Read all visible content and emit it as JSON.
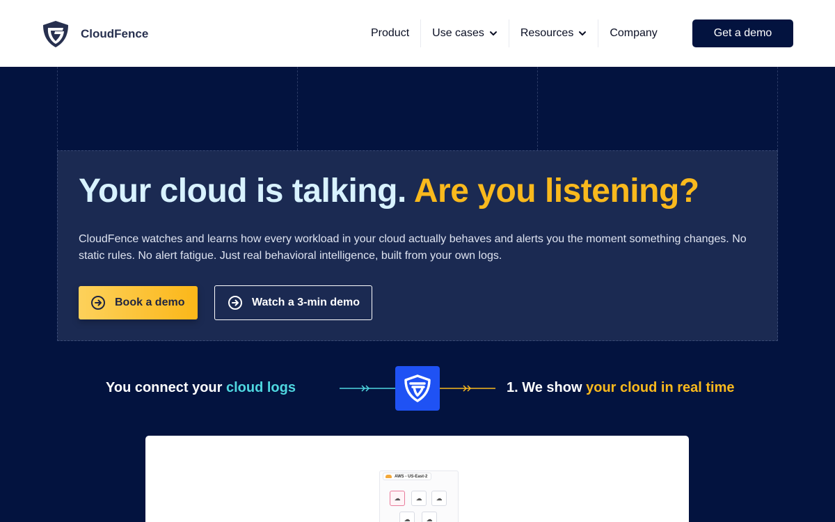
{
  "brand": {
    "name": "CloudFence"
  },
  "nav": {
    "items": [
      {
        "label": "Product",
        "dropdown": false
      },
      {
        "label": "Use cases",
        "dropdown": true
      },
      {
        "label": "Resources",
        "dropdown": true
      },
      {
        "label": "Company",
        "dropdown": false
      }
    ],
    "cta": "Get a demo"
  },
  "hero": {
    "headline_part1": "Your cloud is talking.",
    "headline_part2": "Are you listening?",
    "subtext": "CloudFence watches and learns how every workload in your cloud actually behaves and alerts you the moment something changes. No static rules. No alert fatigue. Just real behavioral intelligence, built from your own logs.",
    "primary_button": "Book a demo",
    "secondary_button": "Watch a 3-min demo"
  },
  "flow": {
    "left_text": "You connect your ",
    "left_highlight": "cloud logs",
    "right_text": "1. We show ",
    "right_highlight": "your cloud in real time"
  },
  "preview": {
    "region_label": "AWS - US-East-2"
  },
  "colors": {
    "navy": "#03133f",
    "hero_panel": "#1b2a52",
    "accent_yellow": "#f9b91d",
    "accent_cyan": "#4fd7e0",
    "brand_blue": "#1f52f4",
    "headline_light": "#d8f2ff"
  }
}
